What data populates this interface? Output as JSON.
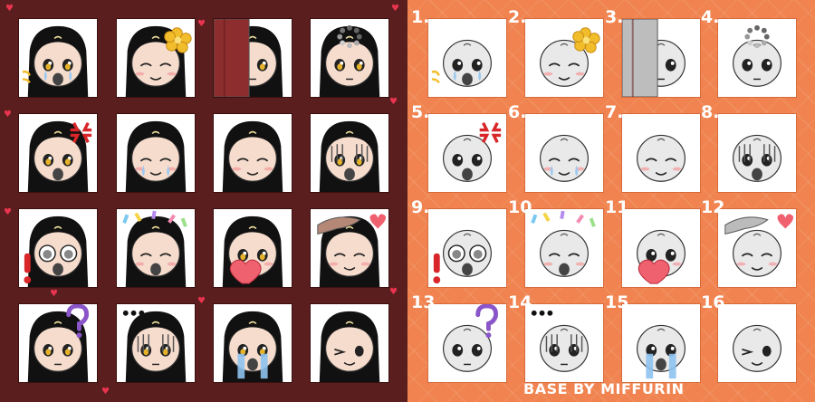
{
  "numbers": [
    "1.",
    "2.",
    "3.",
    "4.",
    "5.",
    "6.",
    "7.",
    "8.",
    "9.",
    "10",
    "11",
    "12",
    "13",
    "14",
    "15",
    "16"
  ],
  "credit": "BASE BY MIFFURIN",
  "colors": {
    "left_background": "#5a1e1e",
    "right_background": "#f0834f",
    "heart": "#e8344f",
    "text": "#ffffff"
  },
  "icons": [
    "heart-icon",
    "flower-icon",
    "anger-icon",
    "question-icon",
    "exclamation-icon",
    "confetti-icon",
    "ellipsis-icon",
    "tear-icon"
  ]
}
